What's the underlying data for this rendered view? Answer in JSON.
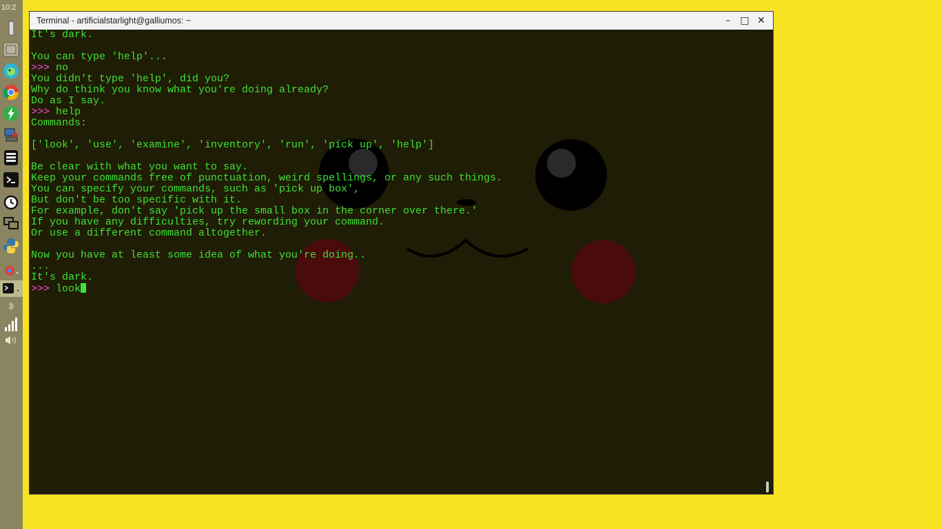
{
  "panel": {
    "clock": "10:2",
    "icons": [
      "usb-drive-icon",
      "file-manager-icon",
      "parakeet-app-icon",
      "chrome-icon",
      "lightning-app-icon",
      "network-workstation-icon",
      "text-editor-icon",
      "terminal-launcher-icon",
      "timer-app-icon",
      "remote-desktop-icon",
      "python-icon",
      "chrome-window-task-icon",
      "terminal-task-icon",
      "bluetooth-icon",
      "signal-strength-icon",
      "volume-icon"
    ]
  },
  "window": {
    "title": "Terminal - artificialstarlight@galliumos: ~",
    "minimize": "–",
    "maximize": "□",
    "close": "✕"
  },
  "terminal": {
    "prompt": ">>>",
    "lines": [
      {
        "type": "out",
        "text": "It's dark."
      },
      {
        "type": "out",
        "text": ""
      },
      {
        "type": "out",
        "text": "You can type 'help'..."
      },
      {
        "type": "in",
        "text": "no"
      },
      {
        "type": "out",
        "text": "You didn't type 'help', did you?"
      },
      {
        "type": "out",
        "text": "Why do think you know what you're doing already?"
      },
      {
        "type": "out",
        "text": "Do as I say."
      },
      {
        "type": "in",
        "text": "help"
      },
      {
        "type": "out",
        "text": "Commands:"
      },
      {
        "type": "out",
        "text": ""
      },
      {
        "type": "out",
        "text": "['look', 'use', 'examine', 'inventory', 'run', 'pick up', 'help']"
      },
      {
        "type": "out",
        "text": ""
      },
      {
        "type": "out",
        "text": "Be clear with what you want to say."
      },
      {
        "type": "out",
        "text": "Keep your commands free of punctuation, weird spellings, or any such things."
      },
      {
        "type": "out",
        "text": "You can specify your commands, such as 'pick up box',"
      },
      {
        "type": "out",
        "text": "But don't be too specific with it."
      },
      {
        "type": "out",
        "text": "For example, don't say 'pick up the small box in the corner over there.'"
      },
      {
        "type": "out",
        "text": "If you have any difficulties, try rewording your command."
      },
      {
        "type": "out",
        "text": "Or use a different command altogether."
      },
      {
        "type": "out",
        "text": ""
      },
      {
        "type": "out",
        "text": "Now you have at least some idea of what you're doing.."
      },
      {
        "type": "out",
        "text": "..."
      },
      {
        "type": "out",
        "text": "It's dark."
      }
    ],
    "current_input": "look"
  },
  "colors": {
    "desktop": "#f7e322",
    "terminal_bg": "#1f1d05",
    "text": "#3ee03a",
    "prompt": "#ff4fd8"
  }
}
